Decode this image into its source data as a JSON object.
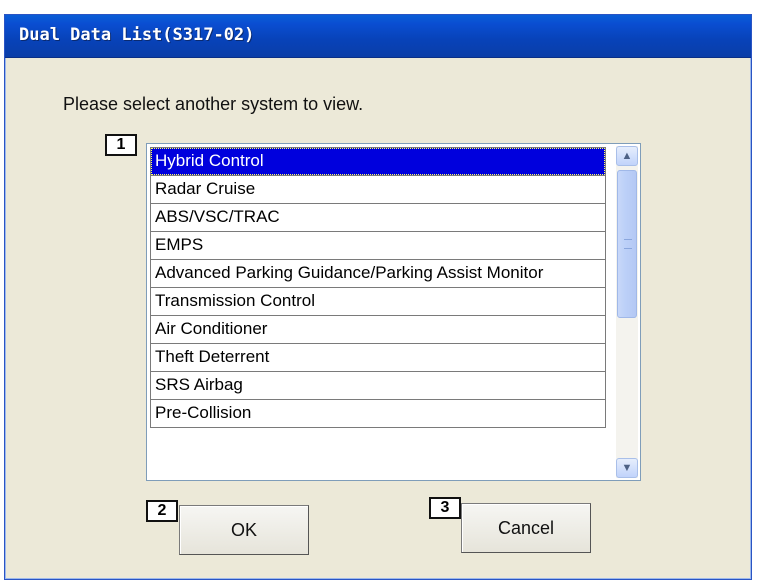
{
  "window": {
    "title": "Dual Data List(S317-02)"
  },
  "prompt": "Please select another system to view.",
  "badges": {
    "list": "1",
    "ok": "2",
    "cancel": "3"
  },
  "systems": [
    "Hybrid Control",
    "Radar Cruise",
    "ABS/VSC/TRAC",
    "EMPS",
    "Advanced Parking Guidance/Parking Assist Monitor",
    "Transmission Control",
    "Air Conditioner",
    "Theft Deterrent",
    "SRS Airbag",
    "Pre-Collision"
  ],
  "selected_index": 0,
  "buttons": {
    "ok": "OK",
    "cancel": "Cancel"
  },
  "icons": {
    "scroll_up": "chevron-up-icon",
    "scroll_down": "chevron-down-icon"
  },
  "colors": {
    "titlebar": "#0a4ed2",
    "selection": "#0000dd",
    "dialog_bg": "#ece9d8"
  }
}
